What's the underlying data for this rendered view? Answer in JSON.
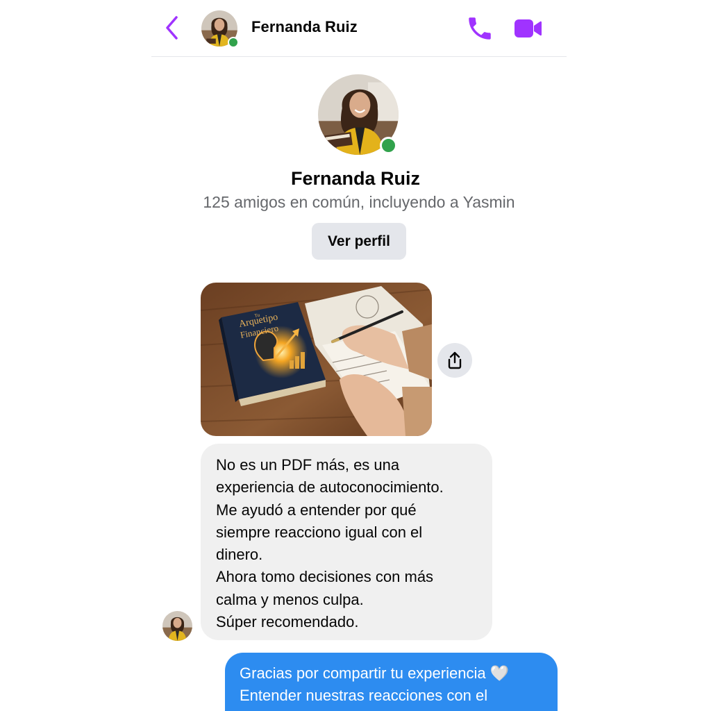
{
  "header": {
    "contact_name": "Fernanda Ruiz",
    "back_icon": "chevron-left-icon",
    "call_icon": "phone-icon",
    "video_icon": "video-camera-icon",
    "accent_color": "#a033ff",
    "online_color": "#31a24c"
  },
  "profile": {
    "name": "Fernanda Ruiz",
    "mutual_friends": "125 amigos en común, incluyendo a Yasmin",
    "view_profile_label": "Ver perfil"
  },
  "messages": {
    "image_message": {
      "book_title_lines": [
        "Tu",
        "Arquetipo",
        "Financiero"
      ],
      "share_icon": "share-icon"
    },
    "incoming_text_lines": [
      "No es un PDF más, es una",
      "experiencia de autoconocimiento.",
      "Me ayudó a entender por qué",
      "siempre reacciono igual con el",
      "dinero.",
      "Ahora tomo decisiones con más",
      "calma y menos culpa.",
      "Súper recomendado."
    ],
    "outgoing_text_lines": [
      "Gracias por compartir tu experiencia 🤍",
      "Entender nuestras reacciones con el"
    ],
    "outgoing_color": "#2d8cf0"
  }
}
